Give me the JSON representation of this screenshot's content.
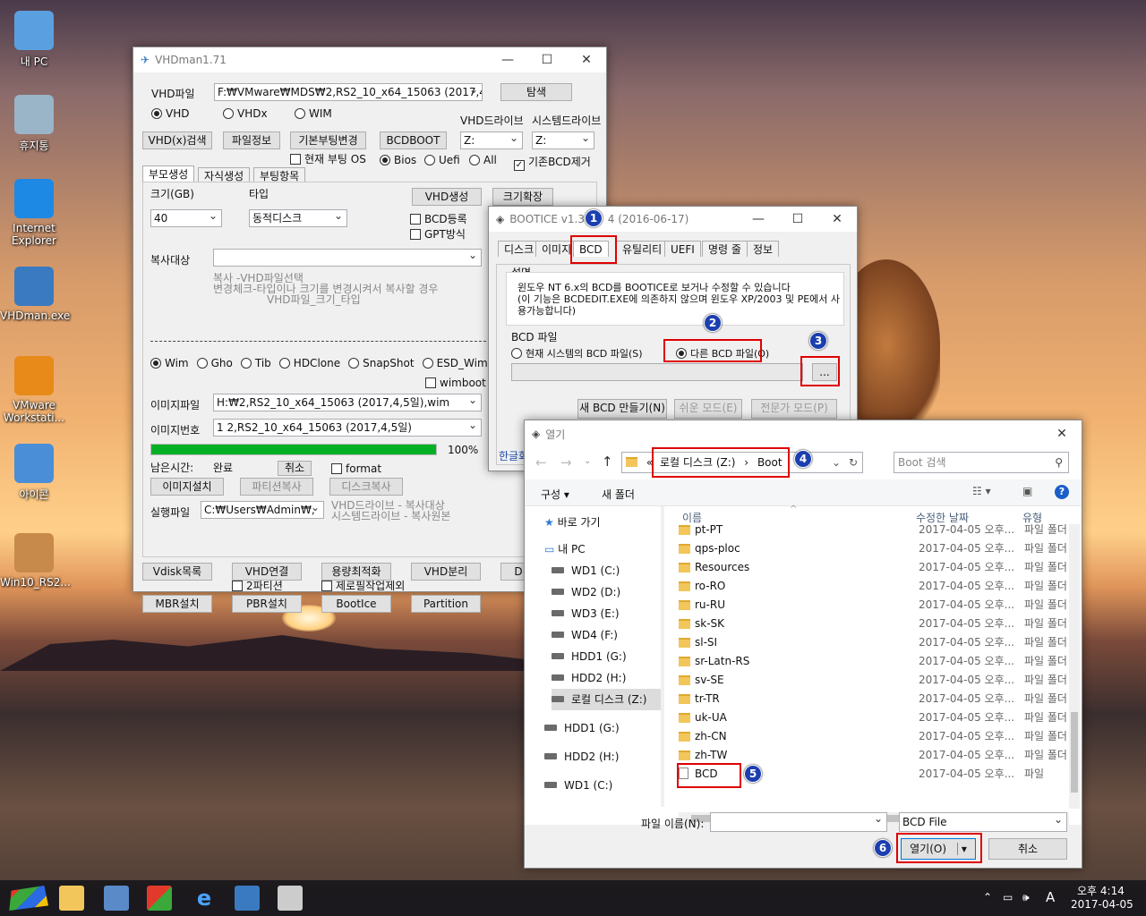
{
  "desktop": {
    "icons": [
      {
        "label": "내 PC",
        "color": "#5aa0e0"
      },
      {
        "label": "휴지통",
        "color": "#9ab4c8"
      },
      {
        "label": "Internet Explorer",
        "color": "#1e88e5"
      },
      {
        "label": "VHDman.exe",
        "color": "#3a7ac0"
      },
      {
        "label": "VMware Workstati...",
        "color": "#e88a1a"
      },
      {
        "label": "아이콘",
        "color": "#4a8ed8"
      },
      {
        "label": "Win10_RS2...",
        "color": "#c78a4a"
      }
    ]
  },
  "vhdman": {
    "title": "VHDman1.71",
    "vhd_file_label": "VHD파일",
    "vhd_file_value": "F:₩VMware₩MDS₩2,RS2_10_x64_15063 (2017,4,",
    "browse_btn": "탐색",
    "format_options": [
      "VHD",
      "VHDx",
      "WIM"
    ],
    "vhd_drive_label": "VHD드라이브",
    "sys_drive_label": "시스템드라이브",
    "btn_vhdx_search": "VHD(x)검색",
    "btn_fileinfo": "파일정보",
    "btn_default_boot": "기본부팅변경",
    "btn_bcdboot": "BCDBOOT",
    "vhd_drive_value": "Z:",
    "sys_drive_value": "Z:",
    "current_boot_os": "현재 부팅 OS",
    "boot_opts": [
      "Bios",
      "Uefi",
      "All"
    ],
    "remove_bcd": "기존BCD제거",
    "tabs": [
      "부모생성",
      "자식생성",
      "부팅항목"
    ],
    "size_label": "크기(GB)",
    "type_label": "타입",
    "size_value": "40",
    "type_value": "동적디스크",
    "btn_vhd_create": "VHD생성",
    "btn_size_expand": "크기확장",
    "bcd_register": "BCD등록",
    "gpt_mode": "GPT방식",
    "copy_target_label": "복사대상",
    "help_lines": [
      "복사       -VHD파일선택",
      "변경체크-타입이나 크기를 변경시켜서 복사할 경우",
      "VHD파일_크기_타입"
    ],
    "image_types": [
      "Wim",
      "Gho",
      "Tib",
      "HDClone",
      "SnapShot",
      "ESD_Wim"
    ],
    "wimboot": "wimboot",
    "image_file_label": "이미지파일",
    "image_file_value": "H:₩2,RS2_10_x64_15063 (2017,4,5일),wim",
    "image_num_label": "이미지번호",
    "image_num_value": "1  2,RS2_10_x64_15063 (2017,4,5일)",
    "progress_percent": 100,
    "progress_text": "100%",
    "remaining_label": "남은시간:",
    "remaining_value": "완료",
    "btn_cancel": "취소",
    "format_chk": "format",
    "btn_image_install": "이미지설치",
    "btn_partition_copy": "파티션복사",
    "btn_disk_copy": "디스크복사",
    "exec_label": "실행파일",
    "exec_value": "C:₩Users₩Admin₩,",
    "exec_help": [
      "VHD드라이브 - 복사대상",
      "시스템드라이브 - 복사원본"
    ],
    "bottom_row1": [
      "Vdisk목록",
      "VHD연결",
      "용량최적화",
      "VHD분리",
      "D"
    ],
    "chk_2partition": "2파티션",
    "chk_zerofill": "제로필작업제외",
    "bottom_row2": [
      "MBR설치",
      "PBR설치",
      "BootIce",
      "Partition"
    ]
  },
  "bootice": {
    "title": "BOOTICE v1.3.4.0 (2016-06-17)",
    "title_visible": "BOOTICE v1.3.",
    "title_rest": "4 (2016-06-17)",
    "tabs": [
      "디스크",
      "이미지",
      "BCD",
      "유틸리티",
      "UEFI",
      "명령 줄",
      "정보"
    ],
    "desc_label": "설명",
    "desc_text": [
      "윈도우 NT 6.x의 BCD를 BOOTICE로 보거나 수정할 수 있습니다",
      "(이 기능은 BCDEDIT.EXE에 의존하지 않으며 윈도우 XP/2003 및 PE에서 사",
      "용가능합니다)"
    ],
    "bcd_file_label": "BCD 파일",
    "opt_current": "현재 시스템의 BCD 파일(S)",
    "opt_other": "다른 BCD 파일(O)",
    "browse": "...",
    "btn_new_bcd": "새 BCD 만들기(N)",
    "btn_easy": "쉬운 모드(E)",
    "btn_expert": "전문가 모드(P)",
    "footer": "한글화"
  },
  "open_dialog": {
    "title": "열기",
    "path_parts": [
      "«",
      "로컬 디스크 (Z:)",
      "›",
      "Boot"
    ],
    "search_placeholder": "Boot 검색",
    "organize": "구성 ▾",
    "new_folder": "새 폴더",
    "col_name": "이름",
    "col_date": "수정한 날짜",
    "col_type": "유형",
    "nav": [
      "바로 가기",
      "내 PC",
      "WD1 (C:)",
      "WD2 (D:)",
      "WD3 (E:)",
      "WD4 (F:)",
      "HDD1 (G:)",
      "HDD2 (H:)",
      "로컬 디스크 (Z:)",
      "HDD1 (G:)",
      "HDD2 (H:)",
      "WD1 (C:)"
    ],
    "files": [
      {
        "name": "pt-PT",
        "date": "2017-04-05 오후...",
        "type": "파일 폴더"
      },
      {
        "name": "qps-ploc",
        "date": "2017-04-05 오후...",
        "type": "파일 폴더"
      },
      {
        "name": "Resources",
        "date": "2017-04-05 오후...",
        "type": "파일 폴더"
      },
      {
        "name": "ro-RO",
        "date": "2017-04-05 오후...",
        "type": "파일 폴더"
      },
      {
        "name": "ru-RU",
        "date": "2017-04-05 오후...",
        "type": "파일 폴더"
      },
      {
        "name": "sk-SK",
        "date": "2017-04-05 오후...",
        "type": "파일 폴더"
      },
      {
        "name": "sl-SI",
        "date": "2017-04-05 오후...",
        "type": "파일 폴더"
      },
      {
        "name": "sr-Latn-RS",
        "date": "2017-04-05 오후...",
        "type": "파일 폴더"
      },
      {
        "name": "sv-SE",
        "date": "2017-04-05 오후...",
        "type": "파일 폴더"
      },
      {
        "name": "tr-TR",
        "date": "2017-04-05 오후...",
        "type": "파일 폴더"
      },
      {
        "name": "uk-UA",
        "date": "2017-04-05 오후...",
        "type": "파일 폴더"
      },
      {
        "name": "zh-CN",
        "date": "2017-04-05 오후...",
        "type": "파일 폴더"
      },
      {
        "name": "zh-TW",
        "date": "2017-04-05 오후...",
        "type": "파일 폴더"
      },
      {
        "name": "BCD",
        "date": "2017-04-05 오후...",
        "type": "파일"
      }
    ],
    "filename_label": "파일 이름(N):",
    "filename_value": "",
    "filter_value": "BCD File",
    "btn_open": "열기(O)",
    "btn_cancel": "취소"
  },
  "annotations": [
    "1",
    "2",
    "3",
    "4",
    "5",
    "6"
  ],
  "taskbar": {
    "time": "오후 4:14",
    "date": "2017-04-05",
    "ime": "A"
  }
}
